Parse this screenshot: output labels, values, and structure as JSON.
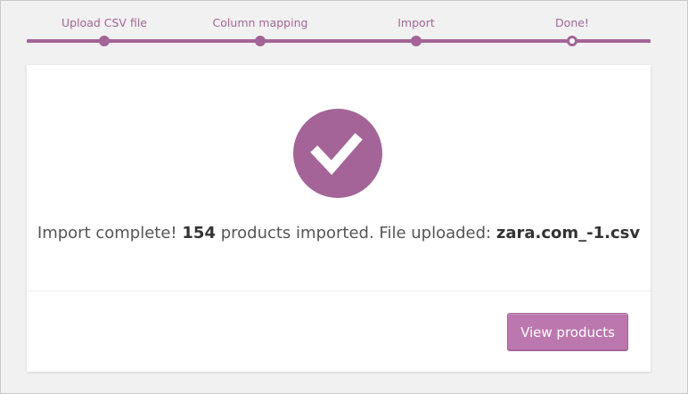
{
  "steps": [
    {
      "label": "Upload CSV file",
      "state": "done"
    },
    {
      "label": "Column mapping",
      "state": "done"
    },
    {
      "label": "Import",
      "state": "done"
    },
    {
      "label": "Done!",
      "state": "current"
    }
  ],
  "colors": {
    "accent": "#a46497",
    "button": "#bb77ae",
    "page_bg": "#f1f1f1"
  },
  "result": {
    "icon": "checkmark-icon",
    "prefix": "Import complete!",
    "count": "154",
    "middle": "products imported. File uploaded:",
    "filename": "zara.com_-1.csv"
  },
  "actions": {
    "view_products": "View products"
  }
}
